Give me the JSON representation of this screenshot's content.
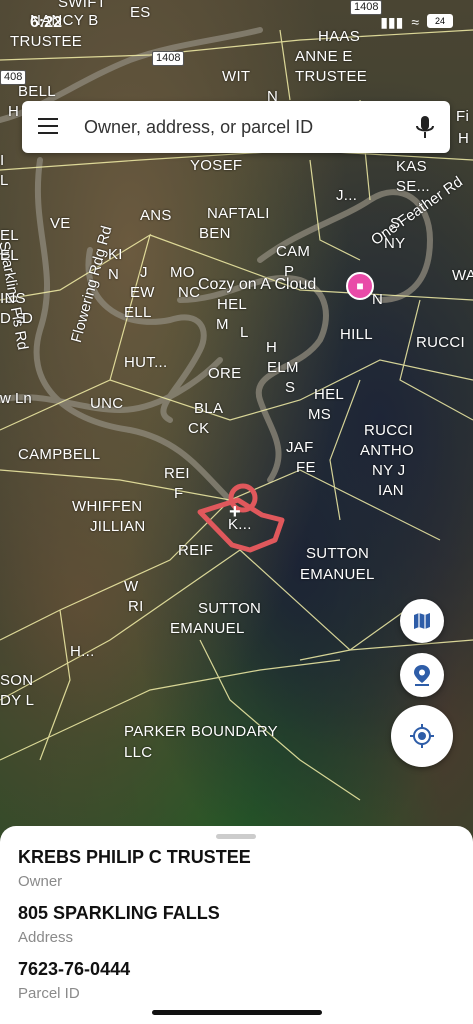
{
  "status_bar": {
    "time": "6:22",
    "battery": "24"
  },
  "search": {
    "placeholder": "Owner, address, or parcel ID"
  },
  "map": {
    "roads": [
      "1408",
      "1408",
      "408"
    ],
    "road_names": [
      "Sparkling Fls Rd",
      "Flowering Rdg Rd",
      "One Feather Rd",
      "w Ln"
    ],
    "place": "Cozy on A Cloud",
    "parcels": [
      "SWIFT",
      "NANCY B",
      "TRUSTEE",
      "ES",
      "HAAS",
      "ANNE E",
      "TRUSTEE",
      "WIT",
      "N",
      "BELL",
      "H",
      "YOSEF",
      "NAFTALI",
      "BEN",
      "ANS",
      "VE",
      "KI",
      "N",
      "J",
      "EW",
      "ELL",
      "MO",
      "NC",
      "HEL",
      "M",
      "L",
      "CAM",
      "P",
      "N",
      "J...",
      "KAS",
      "SE...",
      "S",
      "NY",
      "WA",
      "INS",
      "D S",
      "EL",
      "HUT...",
      "ORE",
      "HILL",
      "RUCCI",
      "H",
      "ELM",
      "S",
      "HEL",
      "MS",
      "UNC",
      "BLA",
      "CK",
      "JAF",
      "FE",
      "RUCCI",
      "ANTHO",
      "NY J",
      "IAN",
      "CAMPBELL",
      "REI",
      "F",
      "K...",
      "WHIFFEN",
      "JILLIAN",
      "REIF",
      "SUTTON",
      "EMANUEL",
      "W",
      "RI",
      "SUTTON",
      "EMANUEL",
      "H...",
      "SON",
      "DY L",
      "PARKER BOUNDARY",
      "LLC",
      "Fi",
      "H",
      "D",
      "EL",
      "L",
      "I"
    ]
  },
  "controls": {
    "layers_icon": "map-icon",
    "pin_icon": "location-pin-icon",
    "locate_icon": "my-location-icon"
  },
  "selected_parcel": {
    "owner": "KREBS PHILIP C TRUSTEE",
    "owner_label": "Owner",
    "address": "805 SPARKLING FALLS",
    "address_label": "Address",
    "parcel_id": "7623-76-0444",
    "parcel_id_label": "Parcel ID"
  },
  "colors": {
    "parcel_lines": "#f4f0a8",
    "selected_outline": "#e0585c",
    "place_pin": "#e94ba8"
  }
}
